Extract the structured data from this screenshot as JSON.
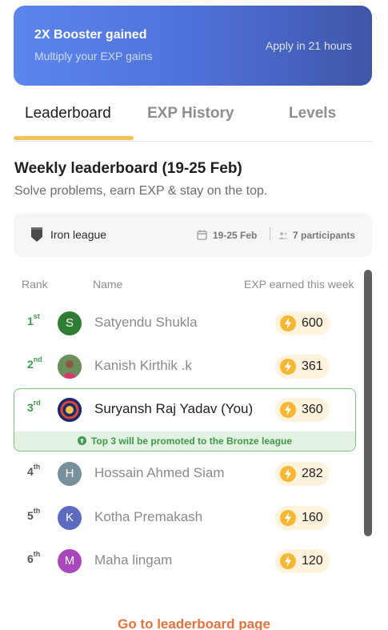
{
  "banner": {
    "title": "2X Booster gained",
    "subtitle": "Multiply your EXP gains",
    "apply": "Apply in 21 hours"
  },
  "tabs": [
    {
      "label": "Leaderboard",
      "active": true
    },
    {
      "label": "EXP History",
      "active": false
    },
    {
      "label": "Levels",
      "active": false
    }
  ],
  "leaderboard": {
    "title": "Weekly leaderboard (19-25 Feb)",
    "subtitle": "Solve problems, earn EXP & stay on the top."
  },
  "league": {
    "name": "Iron league",
    "dates": "19-25 Feb",
    "participants": "7 participants"
  },
  "columns": {
    "rank": "Rank",
    "name": "Name",
    "exp": "EXP earned this week"
  },
  "rows": [
    {
      "rank": "1",
      "suffix": "st",
      "initial": "S",
      "name": "Satyendu Shukla",
      "exp": "600",
      "avatar_color": "#2e7d32"
    },
    {
      "rank": "2",
      "suffix": "nd",
      "initial": "",
      "name": "Kanish Kirthik .k",
      "exp": "361",
      "avatar_color": "#6a9a5a"
    },
    {
      "rank": "3",
      "suffix": "rd",
      "initial": "",
      "name": "Suryansh Raj Yadav (You)",
      "exp": "360",
      "avatar_color": "#1b2a6b"
    },
    {
      "rank": "4",
      "suffix": "th",
      "initial": "H",
      "name": "Hossain Ahmed Siam",
      "exp": "282",
      "avatar_color": "#78909c"
    },
    {
      "rank": "5",
      "suffix": "th",
      "initial": "K",
      "name": "Kotha Premakash",
      "exp": "160",
      "avatar_color": "#5c6bc0"
    },
    {
      "rank": "6",
      "suffix": "th",
      "initial": "M",
      "name": "Maha lingam",
      "exp": "120",
      "avatar_color": "#ab47bc"
    }
  ],
  "promo": "Top 3 will be promoted to the Bronze league",
  "cta": "Go to leaderboard page",
  "colors": {
    "accent": "#f7c25a",
    "promo_green": "#3e9a4c",
    "cta_orange": "#e8703a"
  }
}
